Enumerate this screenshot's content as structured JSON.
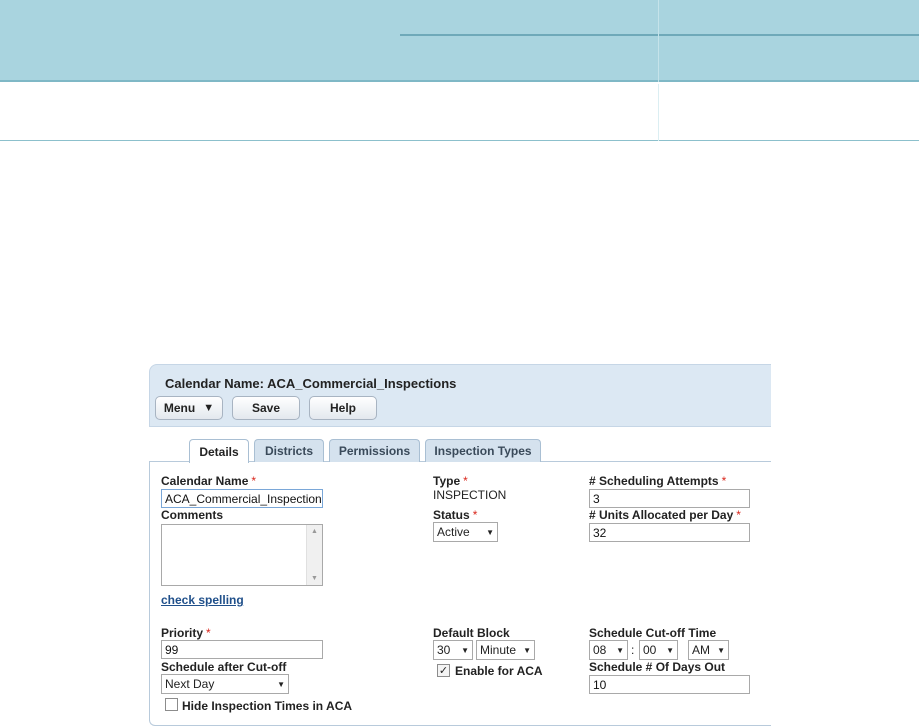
{
  "calendar": {
    "title": "Calendar Name: ACA_Commercial_Inspections"
  },
  "toolbar": {
    "menu_label": "Menu",
    "menu_icon": "menu-icon",
    "save_label": "Save",
    "help_label": "Help"
  },
  "tabs": [
    {
      "label": "Details",
      "active": true
    },
    {
      "label": "Districts",
      "active": false
    },
    {
      "label": "Permissions",
      "active": false
    },
    {
      "label": "Inspection Types",
      "active": false
    }
  ],
  "form": {
    "calendar_name_label": "Calendar Name",
    "calendar_name_value": "ACA_Commercial_Inspections",
    "comments_label": "Comments",
    "comments_value": "",
    "check_spelling": "check spelling",
    "type_label": "Type",
    "type_value": "INSPECTION",
    "status_label": "Status",
    "status_value": "Active",
    "scheduling_attempts_label": "# Scheduling Attempts",
    "scheduling_attempts_value": "3",
    "units_per_day_label": "# Units Allocated per Day",
    "units_per_day_value": "32",
    "priority_label": "Priority",
    "priority_value": "99",
    "schedule_after_cutoff_label": "Schedule after Cut-off",
    "schedule_after_cutoff_value": "Next Day",
    "hide_times_label": "Hide Inspection Times in ACA",
    "hide_times_checked": false,
    "default_block_label": "Default Block",
    "default_block_number": "30",
    "default_block_unit": "Minute",
    "enable_aca_label": "Enable for ACA",
    "enable_aca_checked": true,
    "cutoff_time_label": "Schedule Cut-off Time",
    "cutoff_hour": "08",
    "cutoff_sep": ":",
    "cutoff_minute": "00",
    "cutoff_ampm": "AM",
    "days_out_label": "Schedule # Of Days Out",
    "days_out_value": "10",
    "required_marker": "*"
  },
  "colors": {
    "header_band": "#a9d4df",
    "titlebar": "#dce8f3",
    "link": "#1f4f8a",
    "required": "#d9261c"
  }
}
